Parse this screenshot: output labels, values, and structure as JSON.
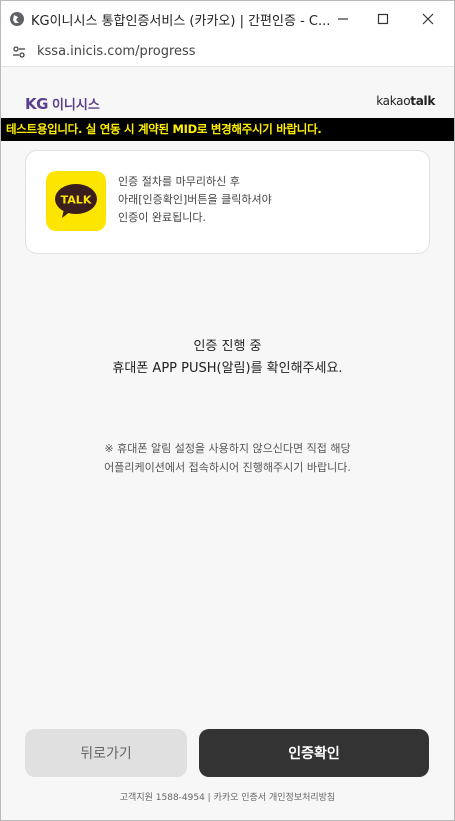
{
  "window": {
    "title": "KG이니시스 통합인증서비스 (카카오) | 간편인증 - C...",
    "url": "kssa.inicis.com/progress"
  },
  "header": {
    "kg_logo": "KG",
    "inicis_logo": "이니시스",
    "kakao_logo_light": "kakao",
    "kakao_logo_bold": "talk"
  },
  "banner": {
    "text": "테스트용입니다. 실 연동 시 계약된 MID로 변경해주시기 바랍니다."
  },
  "info_card": {
    "icon_label": "TALK",
    "lines": [
      "인증 절차를 마무리하신 후",
      "아래[인증확인]버튼을 클릭하셔야",
      "인증이 완료됩니다."
    ]
  },
  "progress": {
    "title": "인증 진행 중",
    "subtitle": "휴대폰 APP PUSH(알림)를 확인해주세요."
  },
  "notice": {
    "line1": "※ 휴대폰 알림 설정을 사용하지 않으신다면 직접 해당",
    "line2": "어플리케이션에서 접속하시어 진행해주시기 바랍니다."
  },
  "buttons": {
    "back": "뒤로가기",
    "confirm": "인증확인"
  },
  "footer": {
    "text": "고객지원 1588-4954 | 카카오 인증서 개인정보처리방침"
  },
  "colors": {
    "kg_purple": "#5a3f8d",
    "banner_bg": "#000000",
    "banner_text": "#ffef00",
    "kakao_yellow": "#fee500",
    "confirm_bg": "#333333",
    "back_bg": "#e0e0e0"
  }
}
